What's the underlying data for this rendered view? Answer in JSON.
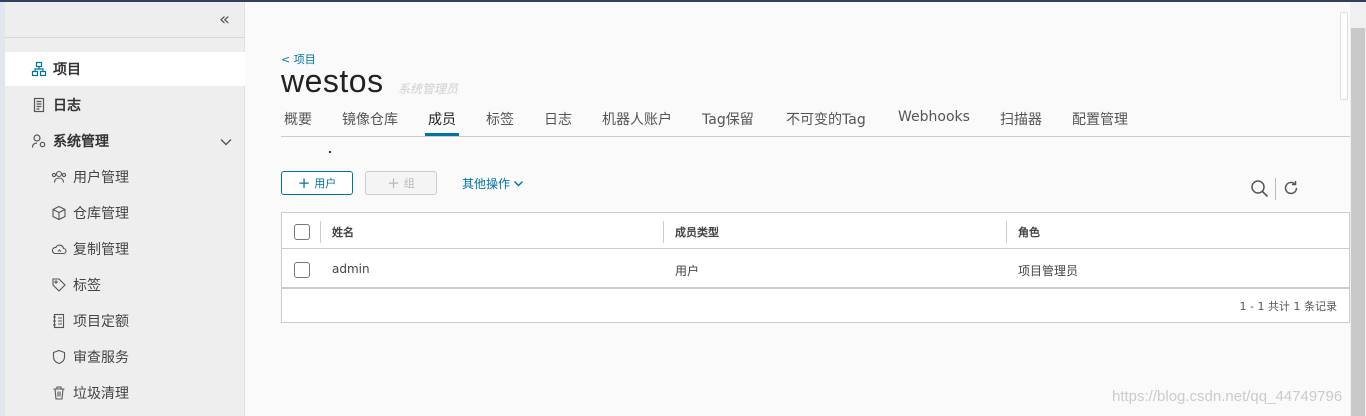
{
  "sidebar": {
    "collapse_icon": "double-chevron-left-icon",
    "items": [
      {
        "label": "项目",
        "icon": "projects-icon"
      },
      {
        "label": "日志",
        "icon": "logs-icon"
      },
      {
        "label": "系统管理",
        "icon": "admin-icon"
      }
    ],
    "sub_items": [
      {
        "label": "用户管理",
        "icon": "users-icon"
      },
      {
        "label": "仓库管理",
        "icon": "registry-icon"
      },
      {
        "label": "复制管理",
        "icon": "replication-icon"
      },
      {
        "label": "标签",
        "icon": "tag-icon"
      },
      {
        "label": "项目定额",
        "icon": "quota-icon"
      },
      {
        "label": "审查服务",
        "icon": "shield-icon"
      },
      {
        "label": "垃圾清理",
        "icon": "trash-icon"
      }
    ]
  },
  "header": {
    "breadcrumb": "< 项目",
    "project_name": "westos",
    "project_role": "系统管理员"
  },
  "tabs": [
    {
      "label": "概要"
    },
    {
      "label": "镜像仓库"
    },
    {
      "label": "成员"
    },
    {
      "label": "标签"
    },
    {
      "label": "日志"
    },
    {
      "label": "机器人账户"
    },
    {
      "label": "Tag保留"
    },
    {
      "label": "不可变的Tag"
    },
    {
      "label": "Webhooks"
    },
    {
      "label": "扫描器"
    },
    {
      "label": "配置管理"
    }
  ],
  "toolbar": {
    "add_user": "用户",
    "add_group": "组",
    "more_actions": "其他操作"
  },
  "table": {
    "headers": [
      "姓名",
      "成员类型",
      "角色"
    ],
    "rows": [
      {
        "name": "admin",
        "type": "用户",
        "role": "项目管理员"
      }
    ],
    "footer": "1 - 1 共计 1 条记录"
  },
  "watermark": "https://blog.csdn.net/qq_44749796",
  "colors": {
    "accent": "#0072a3",
    "sidebar_bg": "#eeeeee",
    "header_bar": "#314159"
  }
}
